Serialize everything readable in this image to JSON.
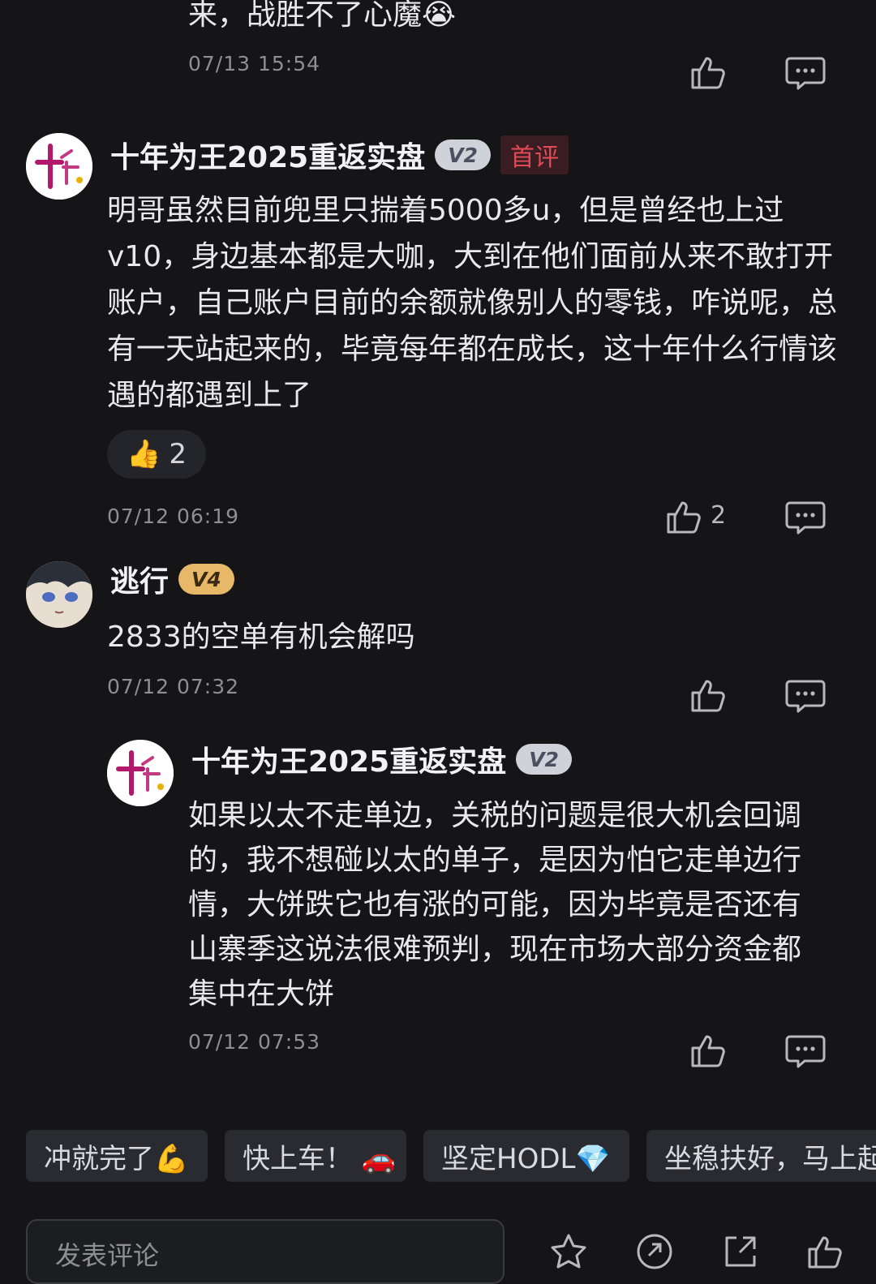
{
  "top_comment": {
    "text_tail": "来，战胜不了心魔😭",
    "time": "07/13 15:54"
  },
  "comment1": {
    "username": "十年为王2025重返实盘",
    "level": "V2",
    "tag": "首评",
    "text": "明哥虽然目前兜里只揣着5000多u，但是曾经也上过v10，身边基本都是大咖，大到在他们面前从来不敢打开账户，自己账户目前的余额就像别人的零钱，咋说呢，总有一天站起来的，毕竟每年都在成长，这十年什么行情该遇的都遇到上了",
    "reaction_emoji": "👍",
    "reaction_count": "2",
    "time": "07/12 06:19",
    "like_count": "2"
  },
  "comment2": {
    "username": "逃行",
    "level": "V4",
    "text": "2833的空单有机会解吗",
    "time": "07/12 07:32"
  },
  "reply1": {
    "username": "十年为王2025重返实盘",
    "level": "V2",
    "text": "如果以太不走单边，关税的问题是很大机会回调的，我不想碰以太的单子，是因为怕它走单边行情，大饼跌它也有涨的可能，因为毕竟是否还有山寨季这说法很难预判，现在市场大部分资金都集中在大饼",
    "time": "07/12 07:53"
  },
  "quick_replies": [
    "冲就完了💪",
    "快上车！ 🚗",
    "坚定HODL💎",
    "坐稳扶好，马上起"
  ],
  "input": {
    "placeholder": "发表评论"
  },
  "icons": {
    "like": "thumbs-up-icon",
    "reply": "comment-bubble-icon",
    "star": "star-icon",
    "share": "share-icon"
  },
  "colors": {
    "background": "#151517",
    "first_tag": "#e24a56",
    "v4_badge": "#e8b869"
  }
}
